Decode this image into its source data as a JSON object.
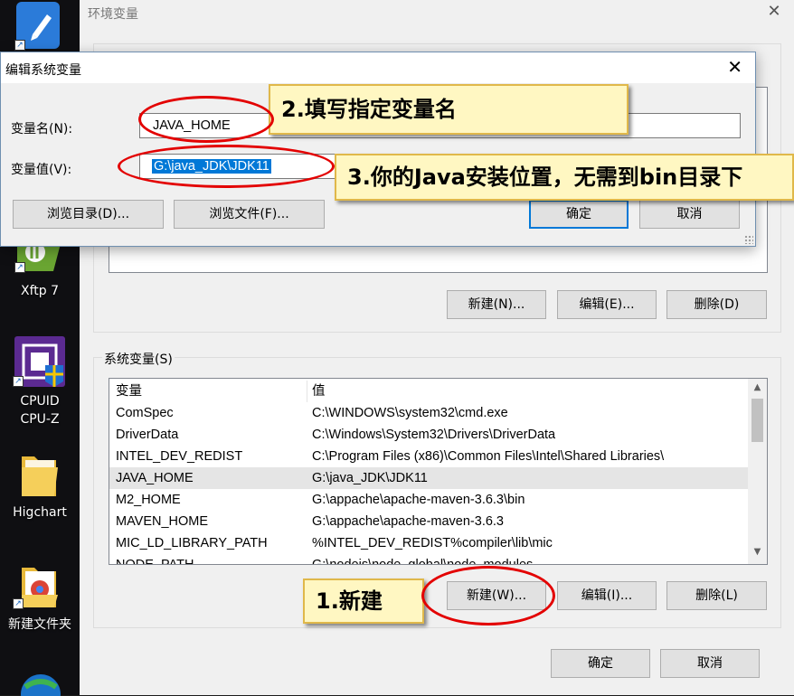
{
  "desktop": {
    "icons": [
      {
        "label": "Xftp 7"
      },
      {
        "label": "CPUID\nCPU-Z"
      },
      {
        "label": "Higchart"
      },
      {
        "label": "新建文件夹"
      }
    ]
  },
  "env_window": {
    "title": "环境变量",
    "user_buttons": {
      "new": "新建(N)...",
      "edit": "编辑(E)...",
      "delete": "删除(D)"
    },
    "system_section": {
      "legend": "系统变量(S)",
      "columns": [
        "变量",
        "值"
      ],
      "rows": [
        {
          "name": "ComSpec",
          "value": "C:\\WINDOWS\\system32\\cmd.exe"
        },
        {
          "name": "DriverData",
          "value": "C:\\Windows\\System32\\Drivers\\DriverData"
        },
        {
          "name": "INTEL_DEV_REDIST",
          "value": "C:\\Program Files (x86)\\Common Files\\Intel\\Shared Libraries\\"
        },
        {
          "name": "JAVA_HOME",
          "value": "G:\\java_JDK\\JDK11"
        },
        {
          "name": "M2_HOME",
          "value": "G:\\appache\\apache-maven-3.6.3\\bin"
        },
        {
          "name": "MAVEN_HOME",
          "value": "G:\\appache\\apache-maven-3.6.3"
        },
        {
          "name": "MIC_LD_LIBRARY_PATH",
          "value": "%INTEL_DEV_REDIST%compiler\\lib\\mic"
        },
        {
          "name": "NODE_PATH",
          "value": "G:\\nodejs\\node_global\\node_modules"
        }
      ],
      "selected_row": "JAVA_HOME",
      "buttons": {
        "new": "新建(W)...",
        "edit": "编辑(I)...",
        "delete": "删除(L)"
      }
    },
    "footer": {
      "ok": "确定",
      "cancel": "取消"
    }
  },
  "edit_dialog": {
    "title": "编辑系统变量",
    "name_label": "变量名(N):",
    "name_value": "JAVA_HOME",
    "value_label": "变量值(V):",
    "value_value": "G:\\java_JDK\\JDK11",
    "browse_dir": "浏览目录(D)...",
    "browse_file": "浏览文件(F)...",
    "ok": "确定",
    "cancel": "取消"
  },
  "annotations": {
    "step1": "1.新建",
    "step2": "2.填写指定变量名",
    "step3": "3.你的Java安装位置，无需到bin目录下"
  },
  "colors": {
    "ring": "#e30000",
    "callout_bg": "#fff7c2",
    "selection": "#0078d7"
  }
}
